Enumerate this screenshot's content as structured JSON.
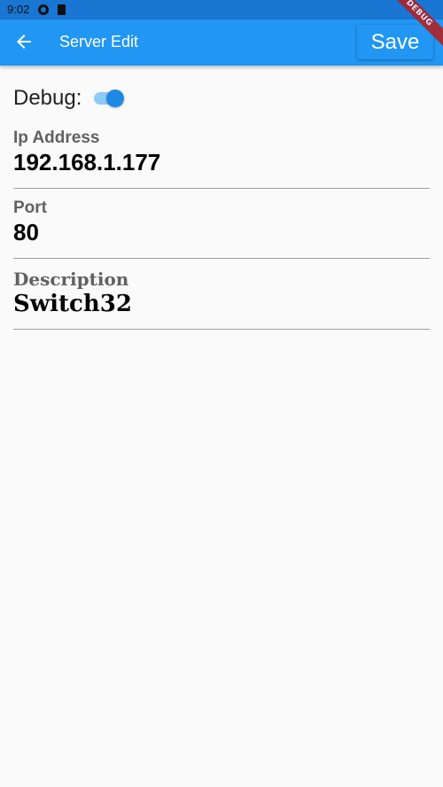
{
  "status_bar": {
    "time": "9:02"
  },
  "app_bar": {
    "title": "Server Edit",
    "save_label": "Save",
    "background_color": "#2196f3",
    "back_icon": "arrow-back-icon"
  },
  "debug_ribbon": {
    "label": "DEBUG"
  },
  "form": {
    "debug": {
      "label": "Debug:",
      "enabled": true
    },
    "ip_address": {
      "label": "Ip Address",
      "value": "192.168.1.177"
    },
    "port": {
      "label": "Port",
      "value": "80"
    },
    "description": {
      "label": "Description",
      "value": "Switch32"
    }
  }
}
